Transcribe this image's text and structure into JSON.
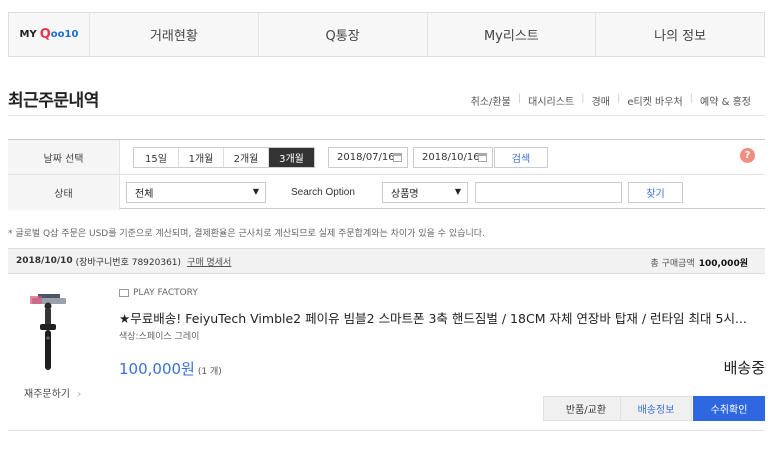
{
  "nav": {
    "logo": {
      "my": "MY",
      "q": "Q",
      "rest": "oo10"
    },
    "items": [
      "거래현황",
      "Q통장",
      "My리스트",
      "나의 정보"
    ]
  },
  "page_title": "최근주문내역",
  "quicklinks": [
    "취소/환불",
    "대시리스트",
    "경매",
    "e티켓 바우처",
    "예약 & 홍정"
  ],
  "filter": {
    "date_label": "날짜 선택",
    "periods": [
      "15일",
      "1개월",
      "2개월",
      "3개월"
    ],
    "active_period": "3개월",
    "date_from": "2018/07/16",
    "date_to": "2018/10/16",
    "search_button": "검색",
    "help": "?",
    "status_label": "상태",
    "status_value": "전체",
    "search_option_label": "Search Option",
    "search_option_value": "상품명",
    "search_text": "",
    "find_button": "찾기"
  },
  "notice": "* 글로벌 Q삽 주문은 USD를 기준으로 계산되며, 결제환율은 근사치로 계산되므로 실제 주문합계와는 차이가 있을 수 있습니다.",
  "order": {
    "date": "2018/10/10",
    "cart_info": "(장바구니번호 78920361)",
    "receipt_link": "구매 명세서",
    "total_label": "총 구매금액",
    "total_value": "100,000원",
    "seller": "PLAY FACTORY",
    "title": "★무료배송! FeiyuTech Vimble2 페이유 빔블2 스마트폰 3축 핸드짐벌 / 18CM 자체 연장바 탑재 / 런타임 최대 5시...",
    "option": "색상:스페이스 그레이",
    "price": "100,000원",
    "qty": "(1 개)",
    "status": "배송중",
    "reorder": "재주문하기",
    "buttons": {
      "return": "반품/교환",
      "shipping": "배송정보",
      "confirm": "수취확인"
    }
  },
  "colors": {
    "accent": "#2f67e0",
    "link": "#3a70d6",
    "logo_q": "#e8344e"
  }
}
